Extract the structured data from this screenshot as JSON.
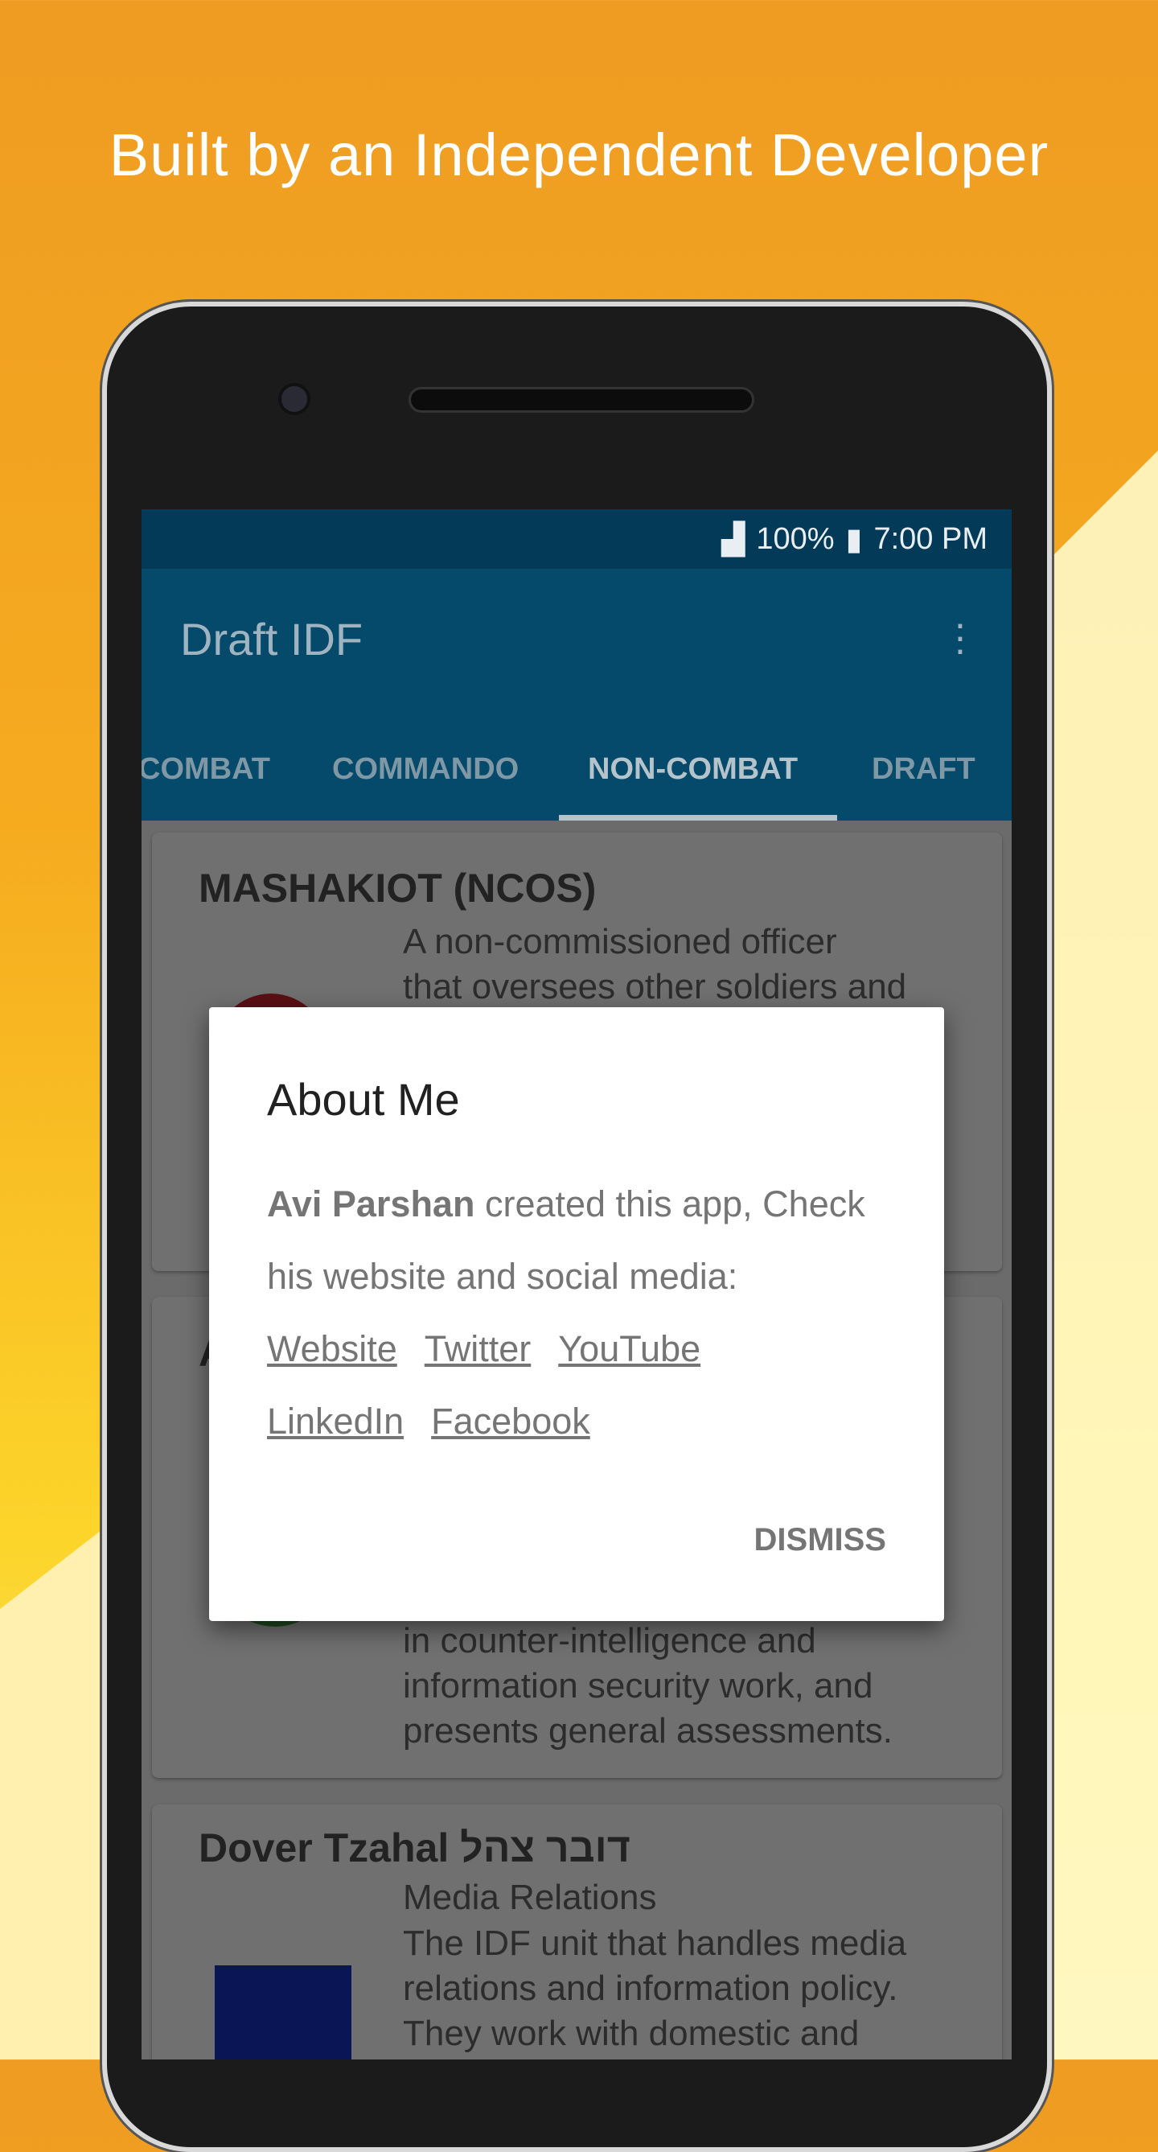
{
  "headline": "Built by an Independent Developer",
  "status_bar": {
    "battery": "100%",
    "time": "7:00 PM"
  },
  "app_bar": {
    "title": "Draft IDF",
    "menu_icon": "more-vert-icon"
  },
  "tabs": [
    {
      "label": "COMBAT"
    },
    {
      "label": "COMMANDO"
    },
    {
      "label": "NON-COMBAT",
      "active": true
    },
    {
      "label": "DRAFT"
    }
  ],
  "cards": [
    {
      "title": "MASHAKIOT (NCOS)",
      "lines": [
        "A non-commissioned officer",
        "that oversees other soldiers and"
      ]
    },
    {
      "title": "A",
      "lines": [
        "in counter-intelligence and",
        "information security work, and",
        "presents general assessments."
      ]
    },
    {
      "title": "Dover Tzahal דובר צהל",
      "subtitle": "Media Relations",
      "lines": [
        "The IDF unit that handles media",
        "relations and information policy.",
        "They work with domestic and"
      ]
    }
  ],
  "dialog": {
    "title": "About Me",
    "author": "Avi Parshan",
    "body": " created this app, Check his website and social media:",
    "links": [
      "Website",
      "Twitter",
      "YouTube",
      "LinkedIn",
      "Facebook"
    ],
    "dismiss": "DISMISS"
  },
  "colors": {
    "app_bar": "#0b86c4",
    "status_bar": "#07649a",
    "background_top": "#ee9c22"
  }
}
